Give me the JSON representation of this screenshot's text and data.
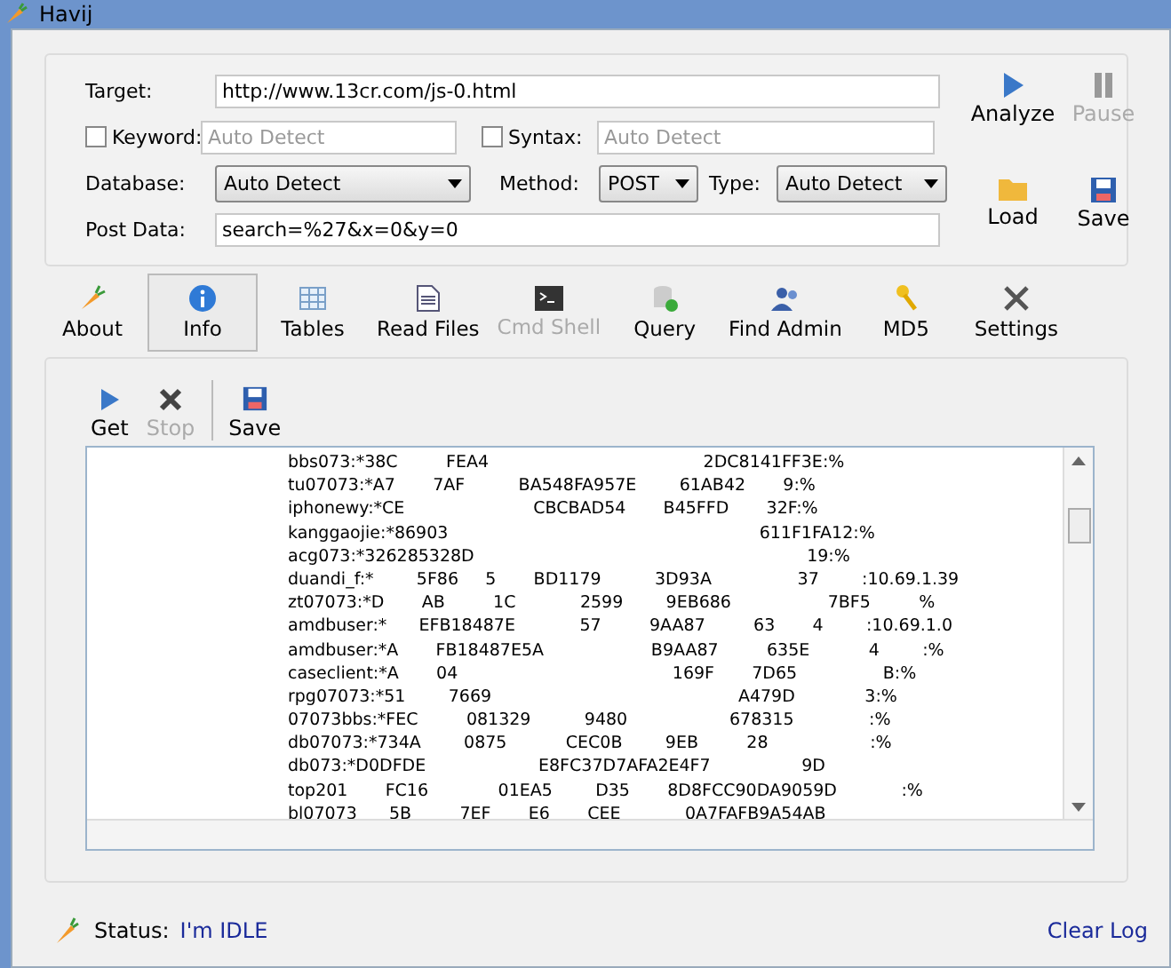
{
  "window": {
    "title": "Havij"
  },
  "form": {
    "target_label": "Target:",
    "target": "http://www.13cr.com/js-0.html",
    "keyword": {
      "label": "Keyword:",
      "checked": false,
      "placeholder": "Auto Detect"
    },
    "syntax": {
      "label": "Syntax:",
      "checked": false,
      "placeholder": "Auto Detect"
    },
    "database": {
      "label": "Database:",
      "value": "Auto Detect"
    },
    "method": {
      "label": "Method:",
      "value": "POST"
    },
    "type": {
      "label": "Type:",
      "value": "Auto Detect"
    },
    "post_data_label": "Post Data:",
    "post_data": "search=%27&x=0&y=0"
  },
  "side_buttons": [
    {
      "kind": "play",
      "label": "Analyze",
      "disabled": false
    },
    {
      "kind": "pause",
      "label": "Pause",
      "disabled": true
    },
    {
      "kind": "folder",
      "label": "Load",
      "disabled": false
    },
    {
      "kind": "disk",
      "label": "Save",
      "disabled": false
    }
  ],
  "tabs": [
    {
      "kind": "carrot",
      "label": "About",
      "selected": false,
      "disabled": false
    },
    {
      "kind": "info",
      "label": "Info",
      "selected": true,
      "disabled": false
    },
    {
      "kind": "table",
      "label": "Tables",
      "selected": false,
      "disabled": false
    },
    {
      "kind": "doc",
      "label": "Read Files",
      "selected": false,
      "disabled": false
    },
    {
      "kind": "terminal",
      "label": "Cmd Shell",
      "selected": false,
      "disabled": true
    },
    {
      "kind": "db",
      "label": "Query",
      "selected": false,
      "disabled": false
    },
    {
      "kind": "users",
      "label": "Find Admin",
      "selected": false,
      "disabled": false
    },
    {
      "kind": "key",
      "label": "MD5",
      "selected": false,
      "disabled": false
    },
    {
      "kind": "tools",
      "label": "Settings",
      "selected": false,
      "disabled": false
    }
  ],
  "toolbar": [
    {
      "kind": "play",
      "label": "Get",
      "disabled": false
    },
    {
      "kind": "cross",
      "label": "Stop",
      "disabled": true
    },
    {
      "kind": "disk",
      "label": "Save",
      "disabled": false
    }
  ],
  "output_lines": [
    "bbs073:*38C         FEA4                                        2DC8141FF3E:%",
    "tu07073:*A7       7AF          BA548FA957E        61AB42       9:%",
    "iphonewy:*CE                        CBCBAD54       B45FFD       32F:%",
    "kanggaojie:*86903                                                          611F1FA12:%",
    "acg073:*326285328D                                                              19:%",
    "duandi_f:*        5F86     5       BD1179          3D93A                37        :10.69.1.39",
    "zt07073:*D       AB         1C            2599        9EB686                  7BF5         %",
    "amdbuser:*      EFB18487E            57         9AA87         63       4        :10.69.1.0",
    "amdbuser:*A       FB18487E5A                    B9AA87         635E           4        :%",
    "caseclient:*A       04                                        169F       7D65                B:%",
    "rpg07073:*51        7669                                              A479D             3:%",
    "07073bbs:*FEC         081329          9480                   678315              :%",
    "db07073:*734A        0875           CEC0B        9EB         28                   :%",
    "db073:*D0DFDE                     E8FC37D7AFA2E4F7                 9D",
    "top201       FC16             01EA5        D35       8D8FCC90DA9059D            :%",
    "bl07073      5B         7EF       E6       CEE            0A7FAFB9A54AB"
  ],
  "status": {
    "label": "Status:",
    "value": "I'm IDLE",
    "clear_log": "Clear Log"
  }
}
